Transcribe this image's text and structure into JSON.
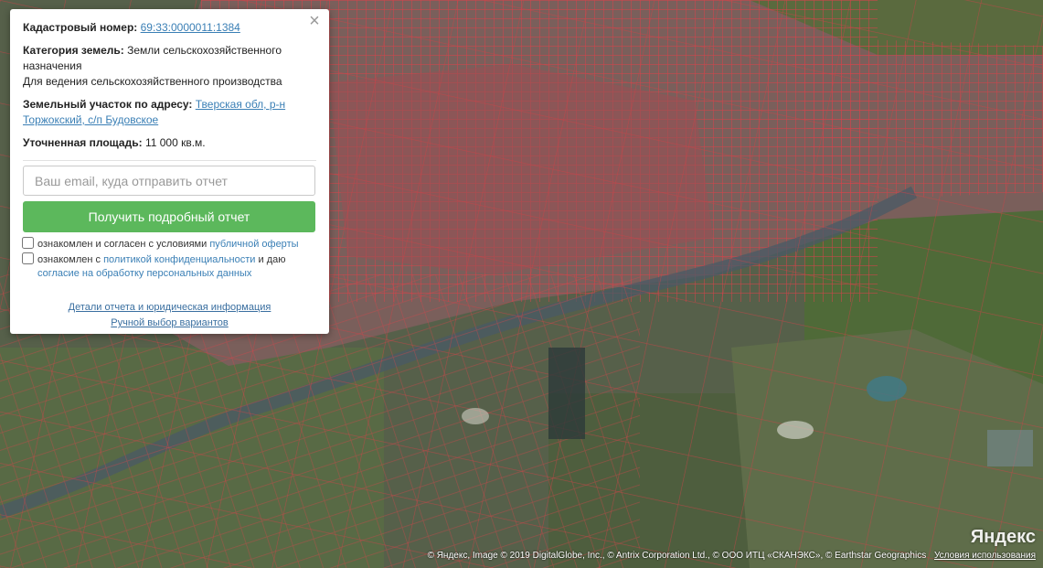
{
  "popup": {
    "cadastral": {
      "label": "Кадастровый номер:",
      "value": "69:33:0000011:1384"
    },
    "category": {
      "label": "Категория земель:",
      "value": "Земли сельскохозяйственного назначения",
      "usage": "Для ведения сельскохозяйственного производства"
    },
    "address": {
      "label": "Земельный участок по адресу:",
      "value": "Тверская обл, р-н Торжокский, с/п Будовское"
    },
    "area": {
      "label": "Уточненная площадь:",
      "value": "11 000 кв.м."
    },
    "email_placeholder": "Ваш email, куда отправить отчет",
    "email_value": "",
    "submit_label": "Получить подробный отчет",
    "offer": {
      "text": "ознакомлен и согласен с условиями",
      "link": "публичной оферты"
    },
    "privacy": {
      "text": "ознакомлен с",
      "link": "политикой конфиденциальности",
      "text2": "и даю",
      "link2": "согласие на обработку персональных данных"
    },
    "details_link": "Детали отчета и юридическая информация",
    "manual_link": "Ручной выбор вариантов",
    "close_icon": "close-icon"
  },
  "map": {
    "parcel_color": "#e0474c",
    "background_color": "#56604a",
    "logo": "Яндекс",
    "copyright": "© Яндекс, Image © 2019 DigitalGlobe, Inc., © Antrix Corporation Ltd., © ООО ИТЦ «СКАНЭКС», © Earthstar Geographics",
    "terms_link": "Условия использования"
  }
}
